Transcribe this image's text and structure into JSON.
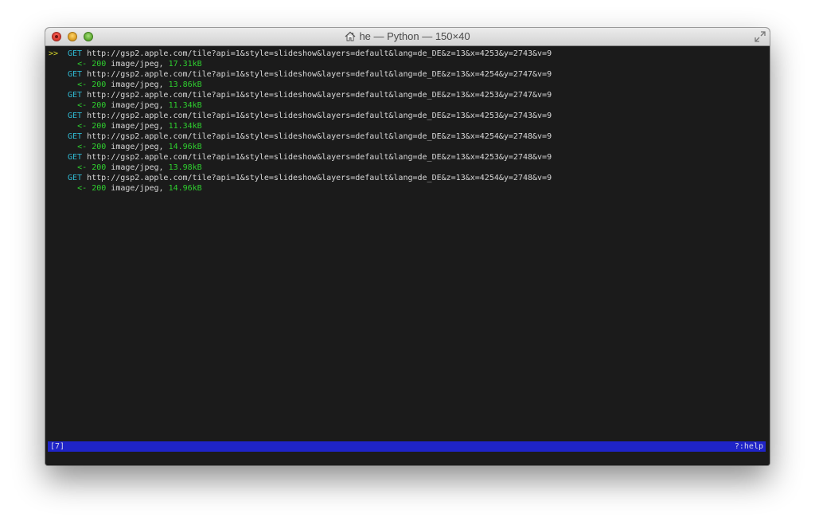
{
  "window": {
    "title": "he — Python — 150×40",
    "icons": {
      "close": "close-dot",
      "minimize": "minimize-dot",
      "zoom": "zoom-dot",
      "home": "home-icon",
      "fullscreen": "fullscreen-icon"
    }
  },
  "terminal": {
    "cursor_marker": ">>",
    "flows": [
      {
        "method": "GET",
        "url": "http://gsp2.apple.com/tile?api=1&style=slideshow&layers=default&lang=de_DE&z=13&x=4253&y=2743&v=9",
        "arrow": "<-",
        "status": "200",
        "content_type": "image/jpeg,",
        "size": "17.31kB"
      },
      {
        "method": "GET",
        "url": "http://gsp2.apple.com/tile?api=1&style=slideshow&layers=default&lang=de_DE&z=13&x=4254&y=2747&v=9",
        "arrow": "<-",
        "status": "200",
        "content_type": "image/jpeg,",
        "size": "13.86kB"
      },
      {
        "method": "GET",
        "url": "http://gsp2.apple.com/tile?api=1&style=slideshow&layers=default&lang=de_DE&z=13&x=4253&y=2747&v=9",
        "arrow": "<-",
        "status": "200",
        "content_type": "image/jpeg,",
        "size": "11.34kB"
      },
      {
        "method": "GET",
        "url": "http://gsp2.apple.com/tile?api=1&style=slideshow&layers=default&lang=de_DE&z=13&x=4253&y=2743&v=9",
        "arrow": "<-",
        "status": "200",
        "content_type": "image/jpeg,",
        "size": "11.34kB"
      },
      {
        "method": "GET",
        "url": "http://gsp2.apple.com/tile?api=1&style=slideshow&layers=default&lang=de_DE&z=13&x=4254&y=2748&v=9",
        "arrow": "<-",
        "status": "200",
        "content_type": "image/jpeg,",
        "size": "14.96kB"
      },
      {
        "method": "GET",
        "url": "http://gsp2.apple.com/tile?api=1&style=slideshow&layers=default&lang=de_DE&z=13&x=4253&y=2748&v=9",
        "arrow": "<-",
        "status": "200",
        "content_type": "image/jpeg,",
        "size": "13.98kB"
      },
      {
        "method": "GET",
        "url": "http://gsp2.apple.com/tile?api=1&style=slideshow&layers=default&lang=de_DE&z=13&x=4254&y=2748&v=9",
        "arrow": "<-",
        "status": "200",
        "content_type": "image/jpeg,",
        "size": "14.96kB"
      }
    ]
  },
  "statusbar": {
    "count": "[7]",
    "help": "?:help"
  },
  "colors": {
    "terminal_bg": "#1b1b1b",
    "method": "#2fb7d0",
    "success": "#2fd02f",
    "cursor": "#d6d62a",
    "statusbar_bg": "#1f24c8"
  }
}
